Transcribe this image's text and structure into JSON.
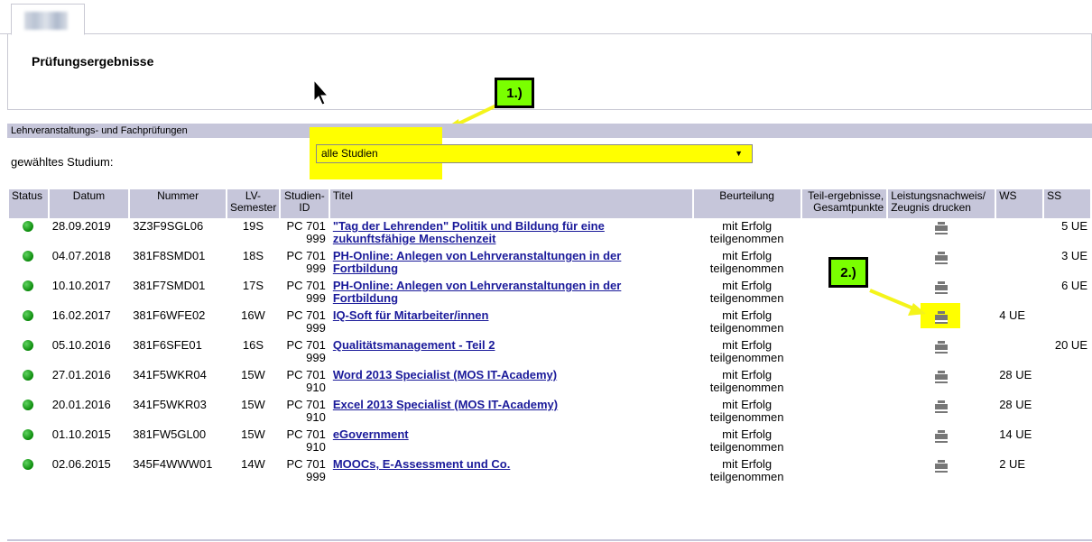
{
  "header": {
    "title": "Prüfungsergebnisse"
  },
  "callouts": {
    "one": "1.)",
    "two": "2.)"
  },
  "section": {
    "title": "Lehrveranstaltungs- und Fachprüfungen"
  },
  "studium": {
    "label": "gewähltes Studium:",
    "selected": "alle Studien"
  },
  "columns": {
    "status": "Status",
    "datum": "Datum",
    "nummer": "Nummer",
    "lv_semester": "LV-Semester",
    "studien_id": "Studien-ID",
    "titel": "Titel",
    "beurteilung": "Beurteilung",
    "teil": "Teil-ergebnisse, Gesamtpunkte",
    "leistung": "Leistungsnachweis/ Zeugnis drucken",
    "ws": "WS",
    "ss": "SS"
  },
  "rows": [
    {
      "datum": "28.09.2019",
      "nummer": "3Z3F9SGL06",
      "sem": "19S",
      "sid": "PC 701 999",
      "titel": "\"Tag der Lehrenden\" Politik und Bildung für eine zukunftsfähige Menschenzeit",
      "beurteilung": "mit Erfolg teilgenommen",
      "ws": "",
      "ss": "5 UE"
    },
    {
      "datum": "04.07.2018",
      "nummer": "381F8SMD01",
      "sem": "18S",
      "sid": "PC 701 999",
      "titel": "PH-Online: Anlegen von Lehrveranstaltungen in der Fortbildung",
      "beurteilung": "mit Erfolg teilgenommen",
      "ws": "",
      "ss": "3 UE"
    },
    {
      "datum": "10.10.2017",
      "nummer": "381F7SMD01",
      "sem": "17S",
      "sid": "PC 701 999",
      "titel": "PH-Online: Anlegen von Lehrveranstaltungen in der Fortbildung",
      "beurteilung": "mit Erfolg teilgenommen",
      "ws": "",
      "ss": "6 UE"
    },
    {
      "datum": "16.02.2017",
      "nummer": "381F6WFE02",
      "sem": "16W",
      "sid": "PC 701 999",
      "titel": "IQ-Soft für Mitarbeiter/innen",
      "beurteilung": "mit Erfolg teilgenommen",
      "ws": "4 UE",
      "ss": ""
    },
    {
      "datum": "05.10.2016",
      "nummer": "381F6SFE01",
      "sem": "16S",
      "sid": "PC 701 999",
      "titel": "Qualitätsmanagement - Teil 2",
      "beurteilung": "mit Erfolg teilgenommen",
      "ws": "",
      "ss": "20 UE"
    },
    {
      "datum": "27.01.2016",
      "nummer": "341F5WKR04",
      "sem": "15W",
      "sid": "PC 701 910",
      "titel": "Word 2013 Specialist (MOS IT-Academy)",
      "beurteilung": "mit Erfolg teilgenommen",
      "ws": "28 UE",
      "ss": ""
    },
    {
      "datum": "20.01.2016",
      "nummer": "341F5WKR03",
      "sem": "15W",
      "sid": "PC 701 910",
      "titel": "Excel 2013 Specialist (MOS IT-Academy)",
      "beurteilung": "mit Erfolg teilgenommen",
      "ws": "28 UE",
      "ss": ""
    },
    {
      "datum": "01.10.2015",
      "nummer": "381FW5GL00",
      "sem": "15W",
      "sid": "PC 701 910",
      "titel": "eGovernment",
      "beurteilung": "mit Erfolg teilgenommen",
      "ws": "14 UE",
      "ss": ""
    },
    {
      "datum": "02.06.2015",
      "nummer": "345F4WWW01",
      "sem": "14W",
      "sid": "PC 701 999",
      "titel": "MOOCs, E-Assessment und Co.",
      "beurteilung": "mit Erfolg teilgenommen",
      "ws": "2 UE",
      "ss": ""
    }
  ],
  "icons": {
    "status": "status-ok-icon",
    "print": "printer-icon",
    "cursor": "mouse-cursor-icon"
  },
  "colors": {
    "header_bg": "#c6c6da",
    "highlight": "#ffff00",
    "callout": "#7aff00",
    "link": "#1a1a9a",
    "status_ok": "#0a8a0a"
  }
}
